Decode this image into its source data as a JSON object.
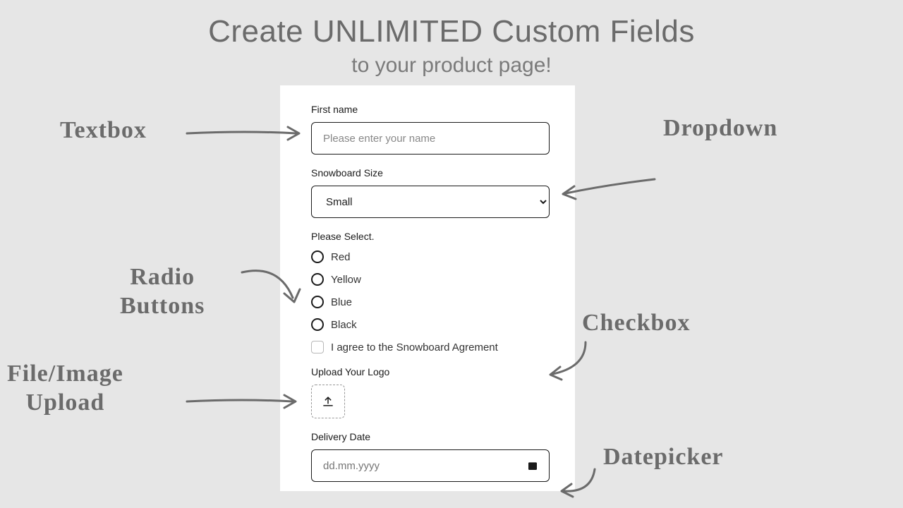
{
  "heading": {
    "title": "Create UNLIMITED Custom Fields",
    "subtitle": "to your product page!"
  },
  "form": {
    "first_name": {
      "label": "First name",
      "placeholder": "Please enter your name"
    },
    "size": {
      "label": "Snowboard Size",
      "selected": "Small"
    },
    "color": {
      "label": "Please Select.",
      "options": [
        "Red",
        "Yellow",
        "Blue",
        "Black"
      ]
    },
    "agreement": {
      "label": "I agree to the Snowboard Agrement"
    },
    "upload": {
      "label": "Upload Your Logo"
    },
    "date": {
      "label": "Delivery Date",
      "placeholder": "dd.mm.yyyy"
    }
  },
  "callouts": {
    "textbox": "Textbox",
    "dropdown": "Dropdown",
    "radio": "Radio\nButtons",
    "checkbox": "Checkbox",
    "upload": "File/Image\nUpload",
    "datepicker": "Datepicker"
  }
}
